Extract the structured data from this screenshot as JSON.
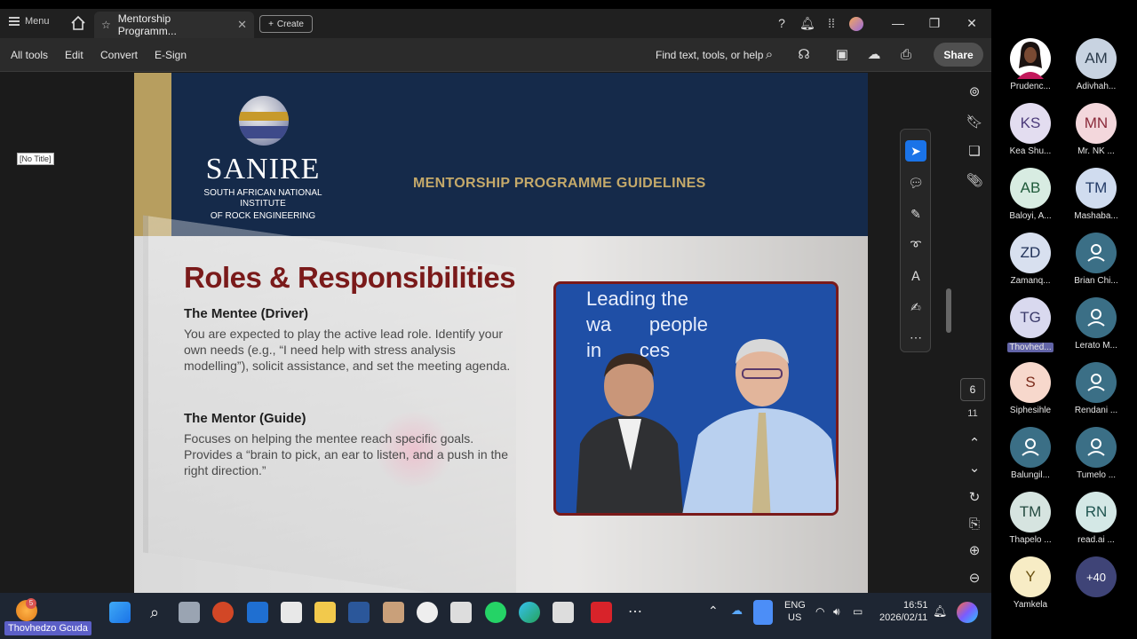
{
  "titlebar": {
    "menu_label": "Menu",
    "tab_title": "Mentorship Programm...",
    "create_label": "Create"
  },
  "toolbar": {
    "items": [
      "All tools",
      "Edit",
      "Convert",
      "E-Sign"
    ],
    "find_label": "Find text, tools, or help",
    "share_label": "Share"
  },
  "sidebar": {
    "no_title": "[No Title]"
  },
  "document": {
    "logo_text": "SANIRE",
    "logo_sub1": "SOUTH AFRICAN NATIONAL INSTITUTE",
    "logo_sub2": "OF ROCK ENGINEERING",
    "headline": "MENTORSHIP PROGRAMME GUIDELINES",
    "section_title": "Roles & Responsibilities",
    "mentee_heading": "The Mentee (Driver)",
    "mentee_text": "You are expected to play the active lead role. Identify your own needs (e.g., “I need help with stress analysis modelling”), solicit assistance, and set the meeting agenda.",
    "mentor_heading": "The Mentor (Guide)",
    "mentor_text": "Focuses on helping the mentee reach specific goals. Provides a “brain to pick, an ear to listen, and a push in the right direction.”",
    "photo_text_1": "Leading the",
    "photo_text_2": "wa       people",
    "photo_text_3": "in       ces"
  },
  "pager": {
    "current": "6",
    "total": "11"
  },
  "taskbar": {
    "badge": "5",
    "lang1": "ENG",
    "lang2": "US",
    "time": "16:51",
    "date": "2026/02/11"
  },
  "presenter_name": "Thovhedzo Gcuda",
  "participants": [
    {
      "initials": "",
      "name": "Prudenc...",
      "bg": "#ffffff",
      "fg": "#222",
      "photo": true
    },
    {
      "initials": "AM",
      "name": "Adivhah...",
      "bg": "#c8d3e1",
      "fg": "#2a3a4a"
    },
    {
      "initials": "KS",
      "name": "Kea Shu...",
      "bg": "#e3ddf0",
      "fg": "#4b3a7a"
    },
    {
      "initials": "MN",
      "name": "Mr. NK ...",
      "bg": "#f3d7dc",
      "fg": "#8a2a3a"
    },
    {
      "initials": "AB",
      "name": "Baloyi, A...",
      "bg": "#d8ece2",
      "fg": "#1f5a3a"
    },
    {
      "initials": "TM",
      "name": "Mashaba...",
      "bg": "#d0dcef",
      "fg": "#223a66"
    },
    {
      "initials": "ZD",
      "name": "Zamanq...",
      "bg": "#d8e0ef",
      "fg": "#22335a"
    },
    {
      "initials": "",
      "name": "Brian Chi...",
      "bg": "#3b6f86",
      "fg": "#fff",
      "generic": true
    },
    {
      "initials": "TG",
      "name": "Thovhed...",
      "bg": "#d9d9ef",
      "fg": "#3a3a6a",
      "highlight": true
    },
    {
      "initials": "",
      "name": "Lerato M...",
      "bg": "#3b6f86",
      "fg": "#fff",
      "generic": true
    },
    {
      "initials": "S",
      "name": "Siphesihle",
      "bg": "#f7d8cc",
      "fg": "#7a2a1a"
    },
    {
      "initials": "",
      "name": "Rendani ...",
      "bg": "#3b6f86",
      "fg": "#fff",
      "generic": true
    },
    {
      "initials": "",
      "name": "Balungil...",
      "bg": "#3b6f86",
      "fg": "#fff",
      "generic": true
    },
    {
      "initials": "",
      "name": "Tumelo ...",
      "bg": "#3b6f86",
      "fg": "#fff",
      "generic": true
    },
    {
      "initials": "TM",
      "name": "Thapelo ...",
      "bg": "#d6e4e0",
      "fg": "#244a40"
    },
    {
      "initials": "RN",
      "name": "read.ai ...",
      "bg": "#d4e8e6",
      "fg": "#1f5450"
    },
    {
      "initials": "Y",
      "name": "Yamkela",
      "bg": "#f7ecc5",
      "fg": "#6a5010"
    },
    {
      "initials": "+40",
      "name": "",
      "bg": "#3f4477",
      "fg": "#fff",
      "small": true
    }
  ]
}
